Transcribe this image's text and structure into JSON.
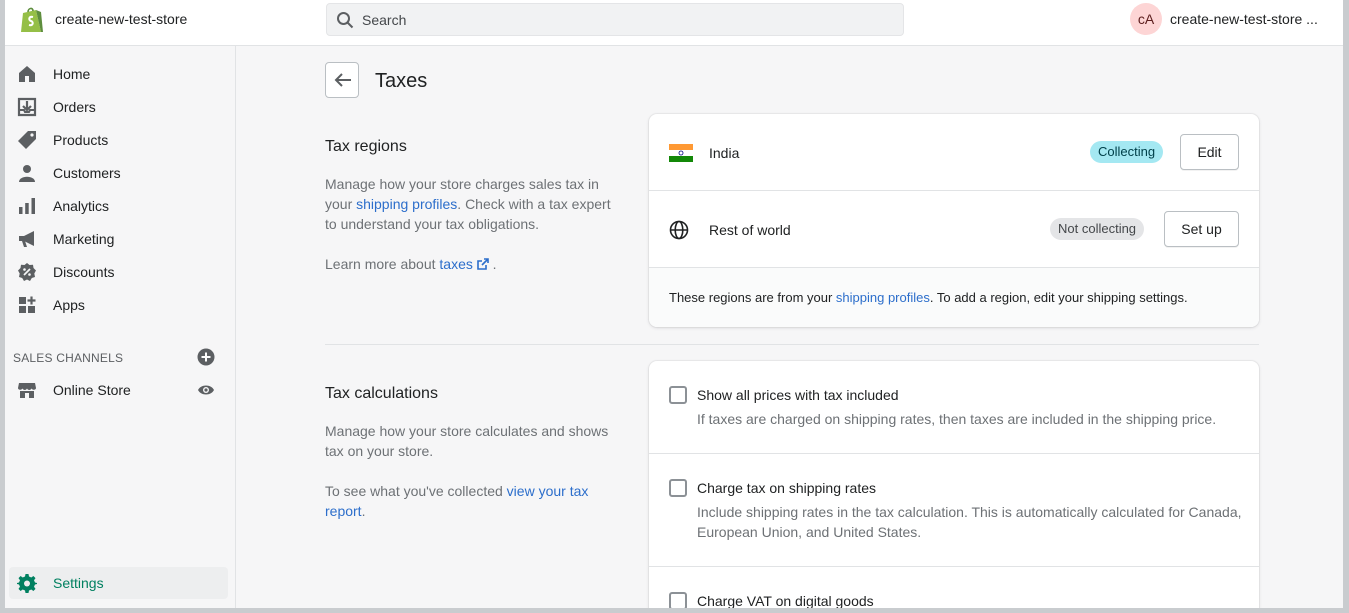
{
  "topbar": {
    "store_name": "create-new-test-store",
    "search_placeholder": "Search",
    "avatar_initials": "cA",
    "account_name": "create-new-test-store ..."
  },
  "sidebar": {
    "items": [
      {
        "label": "Home",
        "icon": "home-icon"
      },
      {
        "label": "Orders",
        "icon": "orders-icon"
      },
      {
        "label": "Products",
        "icon": "tag-icon"
      },
      {
        "label": "Customers",
        "icon": "person-icon"
      },
      {
        "label": "Analytics",
        "icon": "bar-chart-icon"
      },
      {
        "label": "Marketing",
        "icon": "megaphone-icon"
      },
      {
        "label": "Discounts",
        "icon": "discount-icon"
      },
      {
        "label": "Apps",
        "icon": "apps-icon"
      }
    ],
    "sales_channels_label": "SALES CHANNELS",
    "online_store_label": "Online Store",
    "settings_label": "Settings",
    "accent_color": "#008060"
  },
  "page": {
    "title": "Taxes"
  },
  "tax_regions": {
    "title": "Tax regions",
    "desc_part1": "Manage how your store charges sales tax in your ",
    "desc_link": "shipping profiles",
    "desc_part2": ". Check with a tax expert to understand your tax obligations.",
    "learn_prefix": "Learn more about ",
    "learn_link": "taxes",
    "learn_suffix": " .",
    "regions": [
      {
        "name": "India",
        "status": "Collecting",
        "action": "Edit"
      },
      {
        "name": "Rest of world",
        "status": "Not collecting",
        "action": "Set up"
      }
    ],
    "footnote_prefix": "These regions are from your ",
    "footnote_link": "shipping profiles",
    "footnote_suffix": ". To add a region, edit your shipping settings."
  },
  "tax_calculations": {
    "title": "Tax calculations",
    "desc": "Manage how your store calculates and shows tax on your store.",
    "report_prefix": "To see what you've collected ",
    "report_link": "view your tax report",
    "report_suffix": ".",
    "options": [
      {
        "label": "Show all prices with tax included",
        "help": "If taxes are charged on shipping rates, then taxes are included in the shipping price.",
        "checked": false
      },
      {
        "label": "Charge tax on shipping rates",
        "help": "Include shipping rates in the tax calculation. This is automatically calculated for Canada, European Union, and United States.",
        "checked": false
      },
      {
        "label": "Charge VAT on digital goods",
        "help": "",
        "checked": false
      }
    ]
  }
}
